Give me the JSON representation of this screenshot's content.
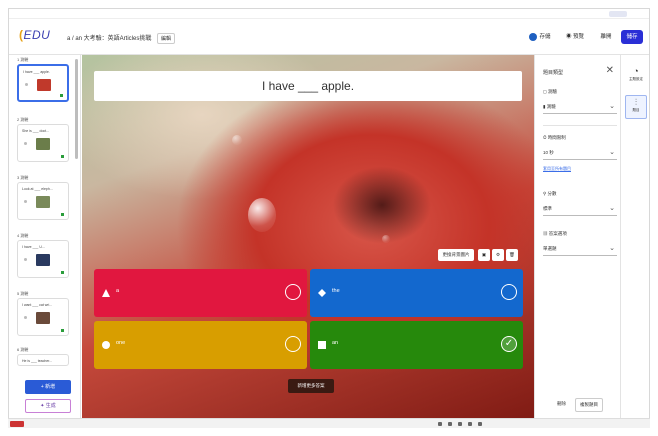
{
  "header": {
    "logo_mark": "(",
    "logo_text": "EDU",
    "title": "a / an 大考驗：英語Articles挑戰",
    "edit_label": "編輯",
    "save_label": "存儲",
    "preview_label": "預覽",
    "exit_label": "離開",
    "done_label": "儲存"
  },
  "slides": [
    {
      "label": "1 測驗",
      "text": "I have ___ apple.",
      "img_color": "#c0392b"
    },
    {
      "label": "2 測驗",
      "text": "She is ___ doct...",
      "img_color": "#6b7d4a"
    },
    {
      "label": "3 測驗",
      "text": "Look at ___ eleph...",
      "img_color": "#7a8a5a"
    },
    {
      "label": "4 測驗",
      "text": "I have ___ U...",
      "img_color": "#2a3a60"
    },
    {
      "label": "5 測驗",
      "text": "I want ___ cat wri...",
      "img_color": "#6a4a3a"
    },
    {
      "label": "6 測驗",
      "text": "He is ___ teacher...",
      "img_color": "#8a6a5a"
    }
  ],
  "left_actions": {
    "add_label": "+ 新增",
    "generate_label": "✦ 生成"
  },
  "question": {
    "text": "I have ___ apple."
  },
  "canvas_tools": {
    "replace_label": "更換背景圖片",
    "icons": [
      "edit-image-icon",
      "settings-icon",
      "delete-icon"
    ]
  },
  "answers": [
    {
      "text": "a",
      "color": "#e1173f",
      "shape": "triangle",
      "correct": false
    },
    {
      "text": "the",
      "color": "#1368ce",
      "shape": "diamond",
      "correct": false
    },
    {
      "text": "one",
      "color": "#d89e00",
      "shape": "circle",
      "correct": false
    },
    {
      "text": "an",
      "color": "#26890c",
      "shape": "square",
      "correct": true
    }
  ],
  "tooltip": "新增更多答案",
  "settings": {
    "title": "題目類型",
    "close": "✕",
    "type_label": "測驗",
    "type_value": "測驗",
    "time_label": "時間限制",
    "time_value": "10 秒",
    "time_link": "套用至所有題目",
    "points_label": "分數",
    "points_value": "標準",
    "answer_label": "答案選項",
    "answer_value": "單選題",
    "delete_label": "刪除",
    "duplicate_label": "複製題目"
  },
  "rail": {
    "item1": "主題設定",
    "item2": "題目"
  }
}
